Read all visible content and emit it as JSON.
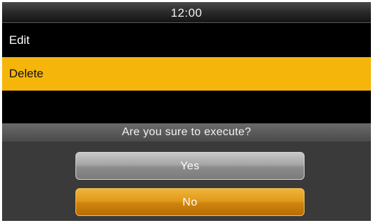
{
  "statusbar": {
    "time": "12:00"
  },
  "menu": {
    "items": [
      {
        "label": "Edit",
        "selected": false
      },
      {
        "label": "Delete",
        "selected": true
      }
    ]
  },
  "dialog": {
    "message": "Are you sure to execute?",
    "yes_label": "Yes",
    "no_label": "No"
  },
  "colors": {
    "selection": "#f5b50a",
    "background": "#000000",
    "dialog": "#3a3a3a",
    "yes_button": "#a6a6a6",
    "no_button": "#e19a1b"
  }
}
